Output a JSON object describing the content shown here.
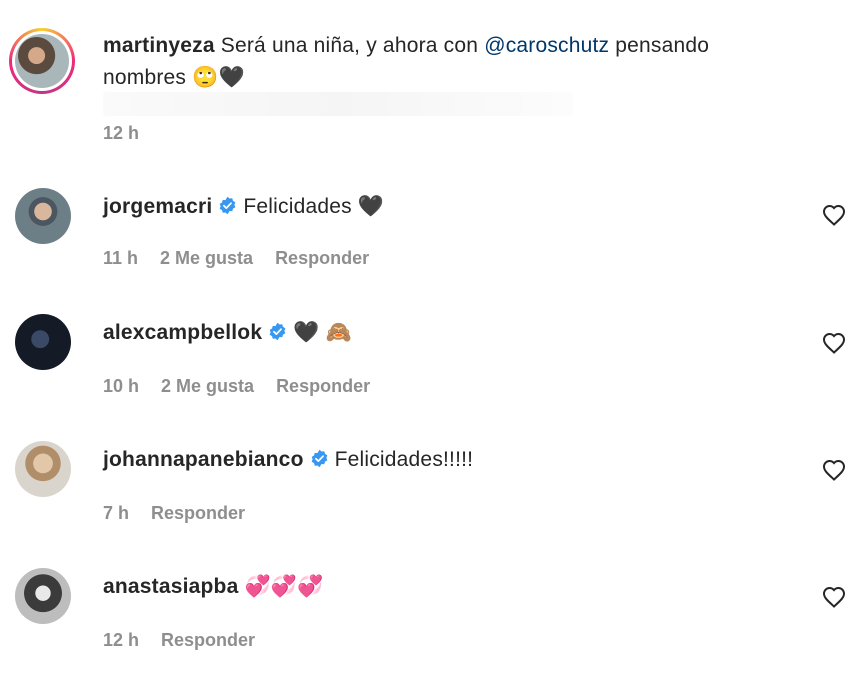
{
  "caption": {
    "username": "martinyeza",
    "text_before": "Será una niña, y ahora con ",
    "mention": "@caroschutz",
    "text_after": " pensando",
    "text_line2": "nombres 🙄🖤",
    "time": "12 h"
  },
  "comments": [
    {
      "username": "jorgemacri",
      "verified": true,
      "text": "Felicidades 🖤",
      "time": "11 h",
      "likes": "2 Me gusta",
      "reply": "Responder"
    },
    {
      "username": "alexcampbellok",
      "verified": true,
      "text": "🖤 🙈",
      "time": "10 h",
      "likes": "2 Me gusta",
      "reply": "Responder"
    },
    {
      "username": "johannapanebianco",
      "verified": true,
      "text": "Felicidades!!!!!",
      "time": "7 h",
      "reply": "Responder"
    },
    {
      "username": "anastasiapba",
      "verified": false,
      "text": "💞💞💞",
      "time": "12 h",
      "reply": "Responder"
    }
  ],
  "icons": {
    "verified": "verified-badge-icon",
    "like": "heart-outline-icon"
  },
  "colors": {
    "mention": "#00376b",
    "verified": "#3897f0",
    "meta": "#8e8e8e"
  }
}
